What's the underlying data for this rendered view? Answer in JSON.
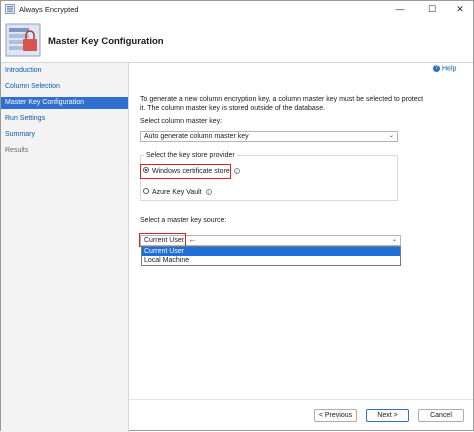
{
  "window": {
    "title": "Always Encrypted",
    "controls": [
      "—",
      "☐",
      "✕"
    ]
  },
  "banner": {
    "title": "Master Key Configuration"
  },
  "sidebar": {
    "items": [
      {
        "label": "Introduction",
        "state": "link"
      },
      {
        "label": "Column Selection",
        "state": "link"
      },
      {
        "label": "Master Key Configuration",
        "state": "active"
      },
      {
        "label": "Run Settings",
        "state": "link"
      },
      {
        "label": "Summary",
        "state": "link"
      },
      {
        "label": "Results",
        "state": "disabled"
      }
    ]
  },
  "help": {
    "label": "Help"
  },
  "main": {
    "description": "To generate a new column encryption key, a column master key must be selected to protect it. The column master key is stored outside of the database.",
    "cmk_label": "Select column master key:",
    "cmk_value": "Auto generate column master key",
    "keystore_label": "Select the key store provider",
    "radios": [
      {
        "label": "Windows certificate store",
        "checked": true
      },
      {
        "label": "Azure Key Vault",
        "checked": false
      }
    ],
    "source_label": "Select a master key source:",
    "source_value": "Current User",
    "source_options": [
      "Current User",
      "Local Machine"
    ]
  },
  "footer": {
    "previous": "< Previous",
    "next": "Next >",
    "cancel": "Cancel"
  },
  "colors": {
    "accent": "#2f6fd0",
    "highlight": "#dd2222",
    "selection": "#1e6fd9"
  }
}
